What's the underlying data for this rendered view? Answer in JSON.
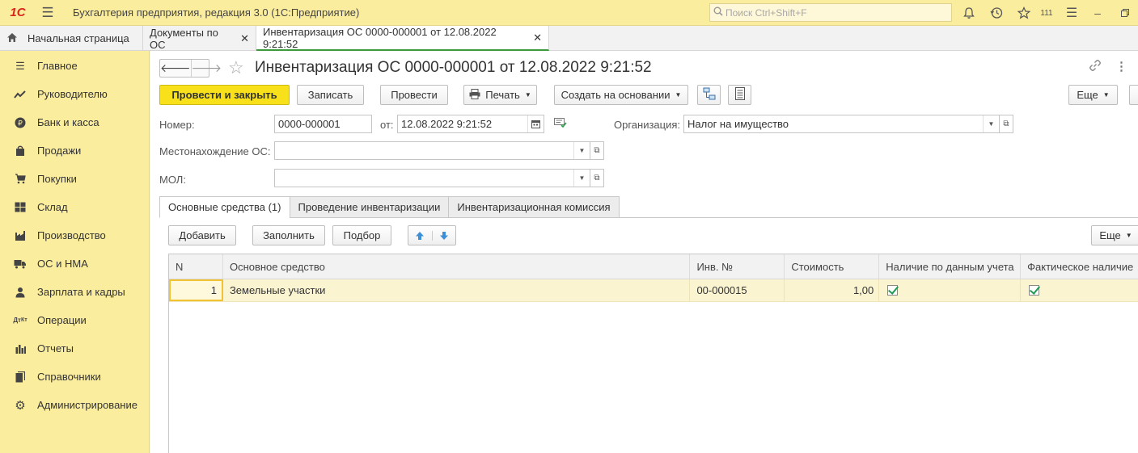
{
  "titlebar": {
    "logo": "1С",
    "title": "Бухгалтерия предприятия, редакция 3.0  (1С:Предприятие)",
    "search_placeholder": "Поиск Ctrl+Shift+F",
    "notifications_count": "111"
  },
  "tabs": [
    {
      "label": "Начальная страница"
    },
    {
      "label": "Документы по ОС"
    },
    {
      "label": "Инвентаризация ОС 0000-000001 от 12.08.2022 9:21:52"
    }
  ],
  "sidebar": {
    "items": [
      {
        "label": "Главное",
        "icon": "menu-icon"
      },
      {
        "label": "Руководителю",
        "icon": "trend-icon"
      },
      {
        "label": "Банк и касса",
        "icon": "ruble-icon"
      },
      {
        "label": "Продажи",
        "icon": "bag-icon"
      },
      {
        "label": "Покупки",
        "icon": "cart-icon"
      },
      {
        "label": "Склад",
        "icon": "warehouse-icon"
      },
      {
        "label": "Производство",
        "icon": "factory-icon"
      },
      {
        "label": "ОС и НМА",
        "icon": "truck-icon"
      },
      {
        "label": "Зарплата и кадры",
        "icon": "person-icon"
      },
      {
        "label": "Операции",
        "icon": "debit-credit-icon"
      },
      {
        "label": "Отчеты",
        "icon": "bar-chart-icon"
      },
      {
        "label": "Справочники",
        "icon": "book-icon"
      },
      {
        "label": "Администрирование",
        "icon": "gear-icon"
      }
    ]
  },
  "document": {
    "title": "Инвентаризация ОС 0000-000001 от 12.08.2022 9:21:52"
  },
  "toolbar": {
    "post_close": "Провести и закрыть",
    "save": "Записать",
    "post": "Провести",
    "print": "Печать",
    "create_based": "Создать на основании",
    "more": "Еще"
  },
  "form": {
    "number_label": "Номер:",
    "number_value": "0000-000001",
    "date_label": "от:",
    "date_value": "12.08.2022  9:21:52",
    "org_label": "Организация:",
    "org_value": "Налог на имущество",
    "location_label": "Местонахождение ОС:",
    "location_value": "",
    "mol_label": "МОЛ:",
    "mol_value": ""
  },
  "form_tabs": [
    {
      "label": "Основные средства (1)"
    },
    {
      "label": "Проведение инвентаризации"
    },
    {
      "label": "Инвентаризационная комиссия"
    }
  ],
  "table_toolbar": {
    "add": "Добавить",
    "fill": "Заполнить",
    "select": "Подбор",
    "more": "Еще"
  },
  "table": {
    "columns": [
      "N",
      "Основное средство",
      "Инв. №",
      "Стоимость",
      "Наличие по данным учета",
      "Фактическое наличие"
    ],
    "rows": [
      {
        "n": "1",
        "asset": "Земельные участки",
        "inv": "00-000015",
        "cost": "1,00",
        "book": true,
        "actual": true
      }
    ]
  }
}
